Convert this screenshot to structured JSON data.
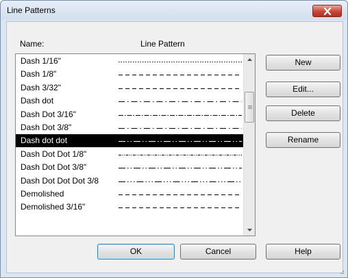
{
  "window": {
    "title": "Line Patterns"
  },
  "list": {
    "header_name": "Name:",
    "header_pattern": "Line Pattern",
    "selected_index": 6,
    "items": [
      {
        "name": "Dash 1/16\"",
        "pattern": "dense-dots"
      },
      {
        "name": "Dash 1/8\"",
        "pattern": "short-dash"
      },
      {
        "name": "Dash 3/32\"",
        "pattern": "short-dash"
      },
      {
        "name": "Dash dot",
        "pattern": "dash-dot"
      },
      {
        "name": "Dash Dot 3/16\"",
        "pattern": "dash-dot-fine"
      },
      {
        "name": "Dash Dot 3/8\"",
        "pattern": "dash-dot"
      },
      {
        "name": "Dash dot dot",
        "pattern": "dash-dot-dot"
      },
      {
        "name": "Dash Dot Dot 1/8\"",
        "pattern": "dense-dashdot"
      },
      {
        "name": "Dash Dot Dot 3/8\"",
        "pattern": "dash-dot-dot"
      },
      {
        "name": "Dash Dot Dot Dot 3/8",
        "pattern": "dash-dot-dot-dot"
      },
      {
        "name": "Demolished",
        "pattern": "short-dash"
      },
      {
        "name": "Demolished 3/16\"",
        "pattern": "short-dash"
      }
    ]
  },
  "buttons": {
    "new": "New",
    "edit": "Edit...",
    "delete": "Delete",
    "rename": "Rename",
    "ok": "OK",
    "cancel": "Cancel",
    "help": "Help"
  },
  "colors": {
    "selection": "#000000",
    "close_button": "#c8473a",
    "default_button_border": "#3c7fb1"
  }
}
